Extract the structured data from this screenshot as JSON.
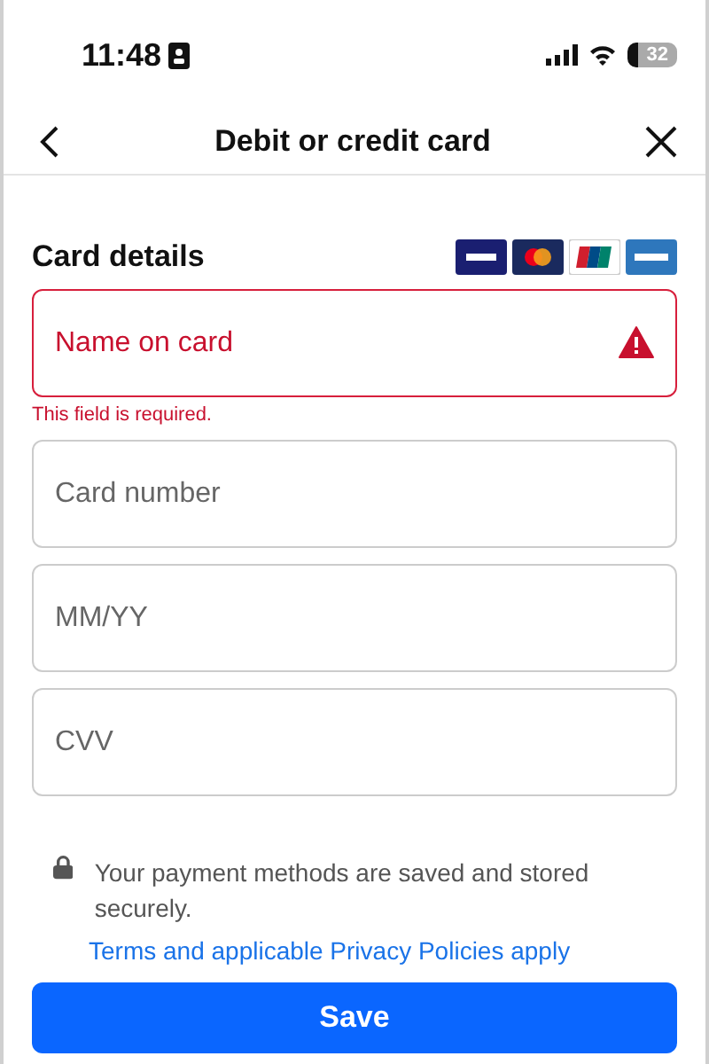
{
  "status_bar": {
    "time": "11:48",
    "battery": "32"
  },
  "header": {
    "title": "Debit or credit card"
  },
  "card_details": {
    "title": "Card details"
  },
  "fields": [
    {
      "placeholder": "Name on card",
      "invalid": true,
      "error": "This field is required."
    },
    {
      "placeholder": "Card number",
      "invalid": false
    },
    {
      "placeholder": "MM/YY",
      "invalid": false
    },
    {
      "placeholder": "CVV",
      "invalid": false
    }
  ],
  "security_note": "Your payment methods are saved and stored securely.",
  "terms_link": "Terms and applicable Privacy Policies apply",
  "save_button": "Save"
}
